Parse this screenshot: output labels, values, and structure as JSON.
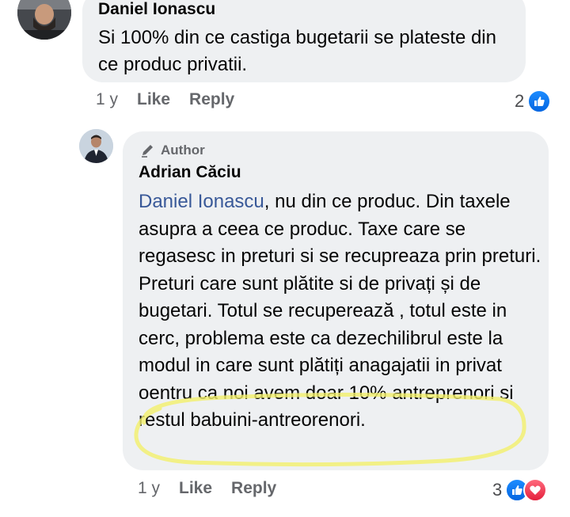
{
  "comment1": {
    "author": "Daniel Ionascu",
    "text": "Si 100% din ce castiga bugetarii se plateste din ce produc privatii.",
    "time": "1 y",
    "like_label": "Like",
    "reply_label": "Reply",
    "reaction_count": "2",
    "reactions": [
      "like-icon"
    ]
  },
  "comment2": {
    "author_badge": "Author",
    "author": "Adrian Căciu",
    "mention": "Daniel Ionascu",
    "text": ", nu din ce produc. Din taxele asupra a ceea ce produc. Taxe care se regasesc in preturi si se recupreaza prin preturi. Preturi care sunt plătite si de privați și de bugetari. Totul se recuperează , totul este in cerc, problema este ca dezechilibrul este la modul in care sunt plătiți anagajatii in privat oentru ca noi avem doar 10% antreprenori si restul babuini-antreorenori.",
    "time": "1 y",
    "like_label": "Like",
    "reply_label": "Reply",
    "reaction_count": "3",
    "reactions": [
      "like-icon",
      "heart-icon"
    ]
  },
  "colors": {
    "bubble_bg": "#eef0f2",
    "meta_gray": "#65676b",
    "mention_blue": "#385898",
    "like_blue": "#1877f2",
    "heart_red": "#f33e58",
    "highlight_yellow": "#f2f06a"
  }
}
